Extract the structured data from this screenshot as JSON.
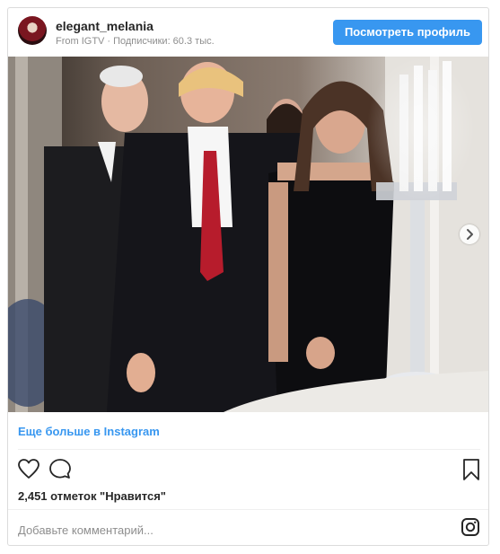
{
  "header": {
    "username": "elegant_melania",
    "source": "From IGTV",
    "separator": "·",
    "followers": "Подписчики: 60.3 тыс.",
    "view_profile_label": "Посмотреть профиль"
  },
  "media": {
    "carousel_next": "chevron-right-icon"
  },
  "footer": {
    "more_link": "Еще больше в Instagram",
    "likes_text": "2,451 отметок \"Нравится\"",
    "comment_placeholder": "Добавьте комментарий..."
  },
  "icons": {
    "like": "heart-icon",
    "comment": "comment-icon",
    "save": "bookmark-icon",
    "instagram": "instagram-icon"
  },
  "colors": {
    "accent": "#3897f0",
    "muted_text": "#8e8e8e",
    "border": "#dbdbdb"
  }
}
